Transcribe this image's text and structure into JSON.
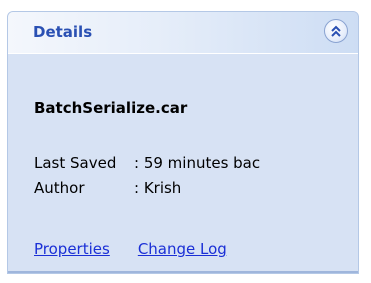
{
  "panel": {
    "title": "Details",
    "collapse_icon": "chevron-double-up-icon",
    "accent_color": "#2a50b3",
    "background_color": "#d7e2f4"
  },
  "details": {
    "filename": "BatchSerialize.car",
    "last_saved_label": "Last Saved",
    "last_saved_value": ": 59 minutes bac",
    "author_label": "Author",
    "author_value": ": Krish"
  },
  "links": {
    "properties": "Properties",
    "change_log": "Change Log",
    "link_color": "#1a2fd6"
  }
}
